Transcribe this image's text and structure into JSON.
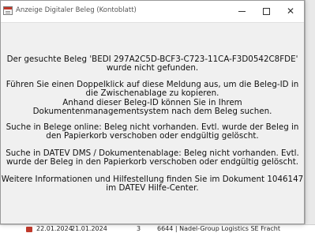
{
  "window": {
    "title": "Anzeige Digitaler Beleg (Kontoblatt)",
    "minimize_glyph": "",
    "maximize_glyph": "",
    "close_glyph": "✕"
  },
  "message": {
    "p1": [
      "Der gesuchte Beleg 'BEDI 297A2C5D-BCF3-C723-11CA-F3D0542C8FDE'",
      "wurde nicht gefunden."
    ],
    "p2": [
      "Führen Sie einen Doppelklick auf diese Meldung aus, um die Beleg-ID in",
      "die Zwischenablage zu kopieren.",
      "Anhand dieser Beleg-ID können Sie in Ihrem",
      "Dokumentenmanagementsystem nach dem Beleg suchen."
    ],
    "p3": [
      "Suche in Belege online: Beleg nicht vorhanden. Evtl. wurde der Beleg in",
      "den Papierkorb verschoben oder endgültig gelöscht."
    ],
    "p4": [
      "Suche in DATEV DMS / Dokumentenablage: Beleg nicht vorhanden. Evtl.",
      "wurde der Beleg in den Papierkorb verschoben oder endgültig gelöscht."
    ],
    "p5": [
      "Weitere Informationen und Hilfestellung finden Sie im Dokument 1046147",
      "im DATEV Hilfe-Center."
    ]
  },
  "background_row": {
    "date1": "22.01.2024",
    "date2": "21.01.2024",
    "number": "3",
    "text": "6644 | Nadel-Group Logistics SE Fracht"
  },
  "icons": {
    "app": "document-icon",
    "row": "pdf-icon"
  },
  "colors": {
    "dialog_bg": "#f0f0f0",
    "titlebar_bg": "#ffffff",
    "text": "#111111"
  }
}
